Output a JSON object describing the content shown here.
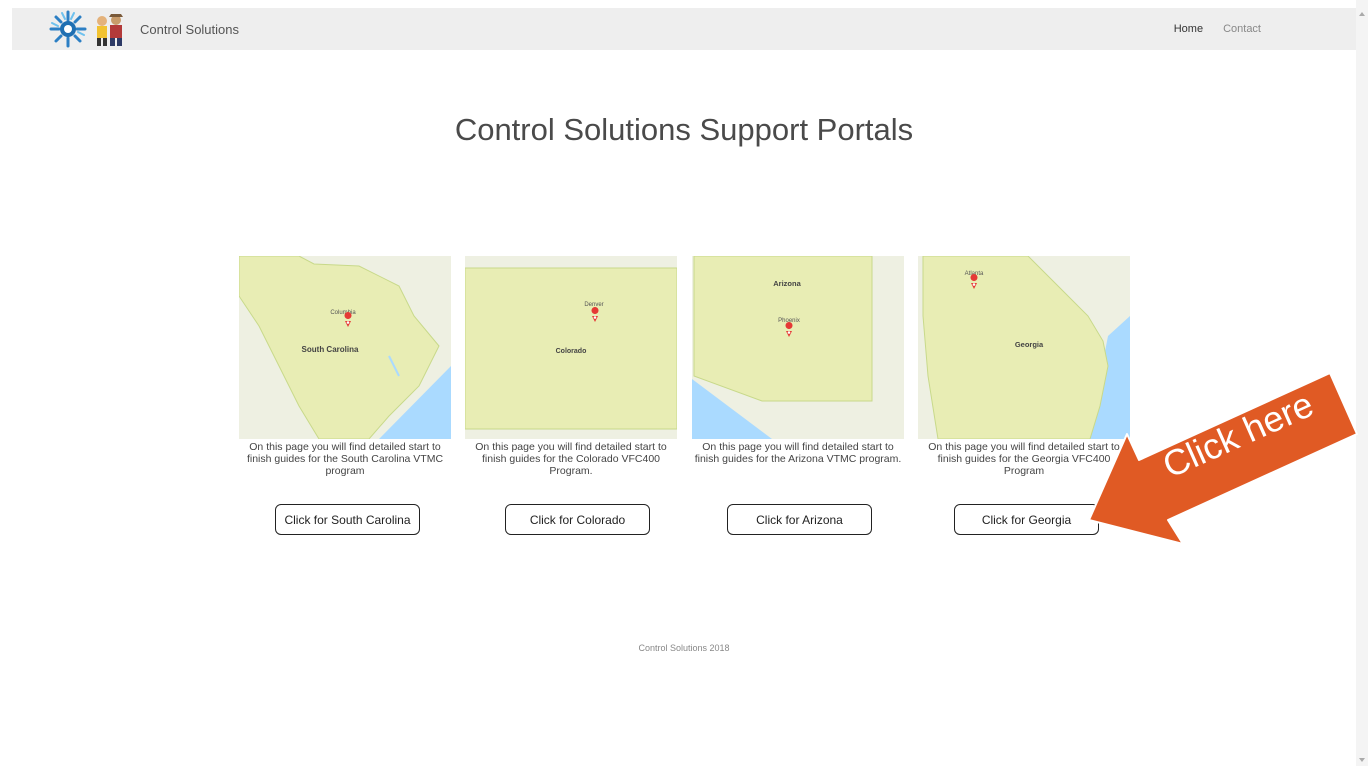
{
  "header": {
    "brand_name": "Control Solutions",
    "nav": {
      "home": "Home",
      "contact": "Contact"
    }
  },
  "page": {
    "title": "Control Solutions Support Portals"
  },
  "cards": [
    {
      "map_state_label": "South Carolina",
      "map_city_label": "Columbia",
      "description": "On this page you will find detailed start to finish guides for the South Carolina VTMC program",
      "button_label": "Click for South Carolina"
    },
    {
      "map_state_label": "Colorado",
      "map_city_label": "Denver",
      "description": "On this page you will find detailed start to finish guides for the Colorado VFC400 Program.",
      "button_label": "Click for Colorado"
    },
    {
      "map_state_label": "Arizona",
      "map_city_label": "Phoenix",
      "description": "On this page you will find detailed start to finish guides for the Arizona VTMC program.",
      "button_label": "Click for Arizona"
    },
    {
      "map_state_label": "Georgia",
      "map_city_label": "Atlanta",
      "description": "On this page you will find detailed start to finish guides for the Georgia VFC400 Program",
      "button_label": "Click for Georgia"
    }
  ],
  "callout": {
    "text": "Click here",
    "color": "#e05a24"
  },
  "footer": {
    "text": "Control Solutions 2018"
  },
  "colors": {
    "map_land": "#e8edb4",
    "map_water": "#aadaff",
    "map_border": "#c8d98a",
    "pin": "#e53935"
  }
}
